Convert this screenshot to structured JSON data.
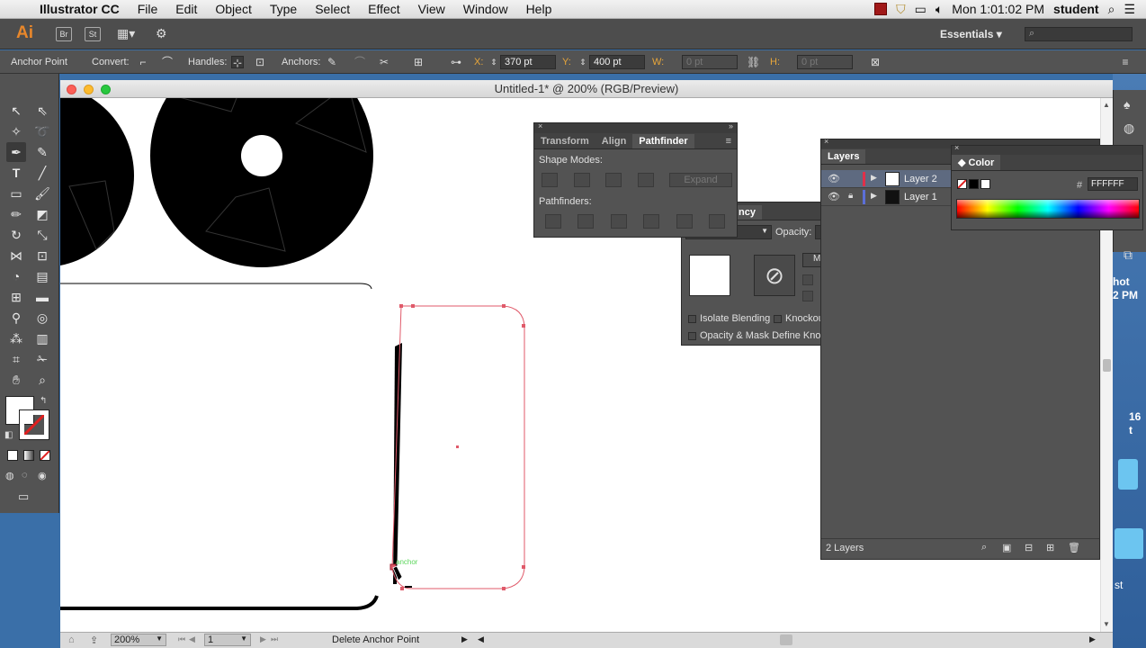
{
  "menubar": {
    "app": "Illustrator CC",
    "items": [
      "File",
      "Edit",
      "Object",
      "Type",
      "Select",
      "Effect",
      "View",
      "Window",
      "Help"
    ],
    "clock": "Mon 1:01:02 PM",
    "user": "student"
  },
  "appbar": {
    "logo": "Ai",
    "bridge": "Br",
    "stock": "St",
    "workspace": "Essentials"
  },
  "control": {
    "tool_name": "Anchor Point",
    "convert_label": "Convert:",
    "handles_label": "Handles:",
    "anchors_label": "Anchors:",
    "x_label": "X:",
    "x_value": "370 pt",
    "y_label": "Y:",
    "y_value": "400 pt",
    "w_label": "W:",
    "w_value": "0 pt",
    "h_label": "H:",
    "h_value": "0 pt"
  },
  "document": {
    "title": "Untitled-1* @ 200% (RGB/Preview)",
    "zoom": "200%",
    "page": "1",
    "status": "Delete Anchor Point",
    "hint_label": "anchor"
  },
  "pathfinder_panel": {
    "tabs": [
      "Transform",
      "Align",
      "Pathfinder"
    ],
    "active_tab": "Pathfinder",
    "shape_modes_label": "Shape Modes:",
    "expand_label": "Expand",
    "pathfinders_label": "Pathfinders:"
  },
  "transparency_panel": {
    "title_fragment": "ncy",
    "opacity_label": "Opacity:",
    "isolate_label": "Isolate Blending",
    "knockout_label": "Knockou",
    "opacity_mask_label": "Opacity & Mask Define Knock",
    "make_mask_fragment": "M"
  },
  "layers_panel": {
    "title": "Layers",
    "layers": [
      {
        "name": "Layer 2",
        "color": "#e0304a",
        "selected": true
      },
      {
        "name": "Layer 1",
        "color": "#5b6fd8",
        "selected": false
      }
    ],
    "count": "2 Layers"
  },
  "color_panel": {
    "title": "Color",
    "hex_label": "#",
    "hex_value": "FFFFFF"
  },
  "desktop": {
    "fragments": [
      "hot",
      "2 PM",
      "16",
      "t",
      "st"
    ]
  },
  "colors": {
    "path_selection": "#e05a6a",
    "ai_orange": "#e8872b"
  }
}
